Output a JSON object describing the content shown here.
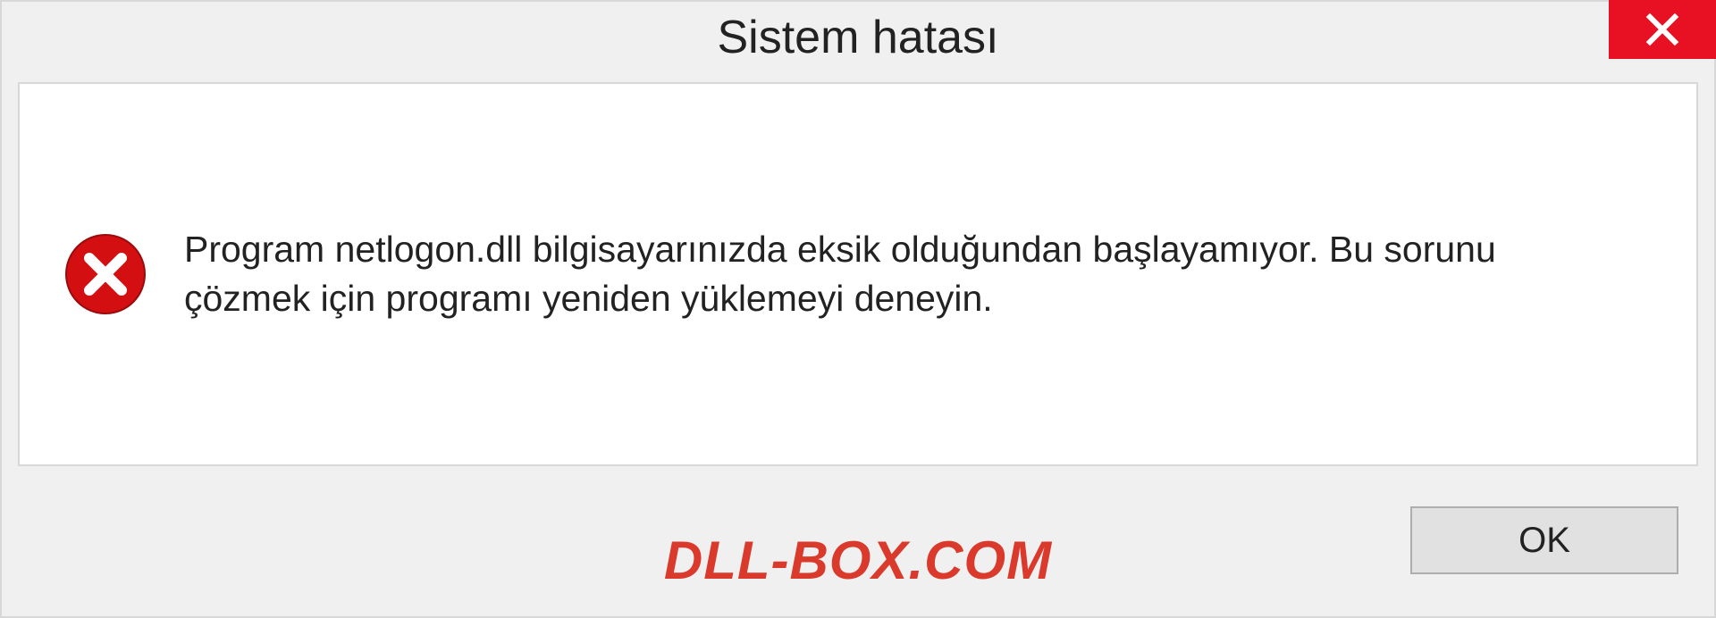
{
  "titlebar": {
    "title": "Sistem hatası"
  },
  "body": {
    "message": "Program netlogon.dll bilgisayarınızda eksik olduğundan başlayamıyor. Bu sorunu çözmek için programı yeniden yüklemeyi deneyin."
  },
  "footer": {
    "watermark": "DLL-BOX.COM",
    "ok_label": "OK"
  },
  "colors": {
    "close_bg": "#e81123",
    "watermark_color": "#d93a2b",
    "error_icon_bg": "#d40f12"
  }
}
